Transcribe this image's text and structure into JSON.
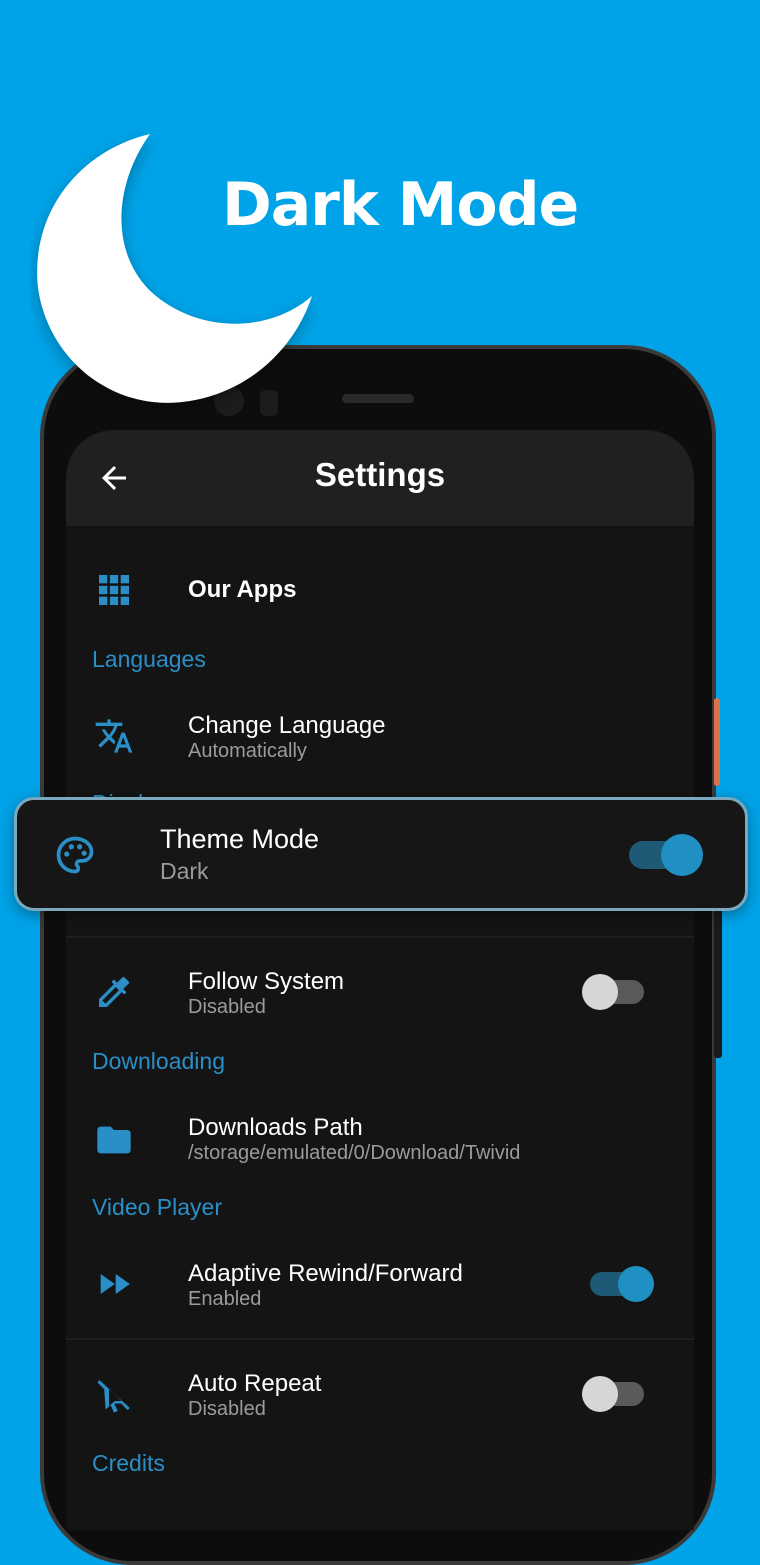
{
  "promo": {
    "headline": "Dark Mode"
  },
  "appbar": {
    "title": "Settings"
  },
  "items": {
    "our_apps": {
      "title": "Our Apps"
    },
    "languages_section": "Languages",
    "change_language": {
      "title": "Change Language",
      "subtitle": "Automatically"
    },
    "display_section_partial": "Displ",
    "theme_mode": {
      "title": "Theme Mode",
      "subtitle": "Dark",
      "enabled": true
    },
    "follow_system": {
      "title": "Follow System",
      "subtitle": "Disabled",
      "enabled": false
    },
    "downloading_section": "Downloading",
    "downloads_path": {
      "title": "Downloads Path",
      "subtitle": "/storage/emulated/0/Download/Twivid"
    },
    "video_player_section": "Video Player",
    "adaptive_rewind": {
      "title": "Adaptive Rewind/Forward",
      "subtitle": "Enabled",
      "enabled": true
    },
    "auto_repeat": {
      "title": "Auto Repeat",
      "subtitle": "Disabled",
      "enabled": false
    },
    "credits_section": "Credits"
  },
  "colors": {
    "background": "#00A3E8",
    "accent": "#2a8fc7",
    "surface": "#141414",
    "appbar": "#202020"
  },
  "icons": {
    "back": "arrow-left-icon",
    "apps": "grid-icon",
    "language": "translate-icon",
    "theme": "palette-icon",
    "follow": "eyedropper-icon",
    "path": "folder-icon",
    "rewind": "fast-forward-icon",
    "repeat": "no-touch-icon"
  }
}
